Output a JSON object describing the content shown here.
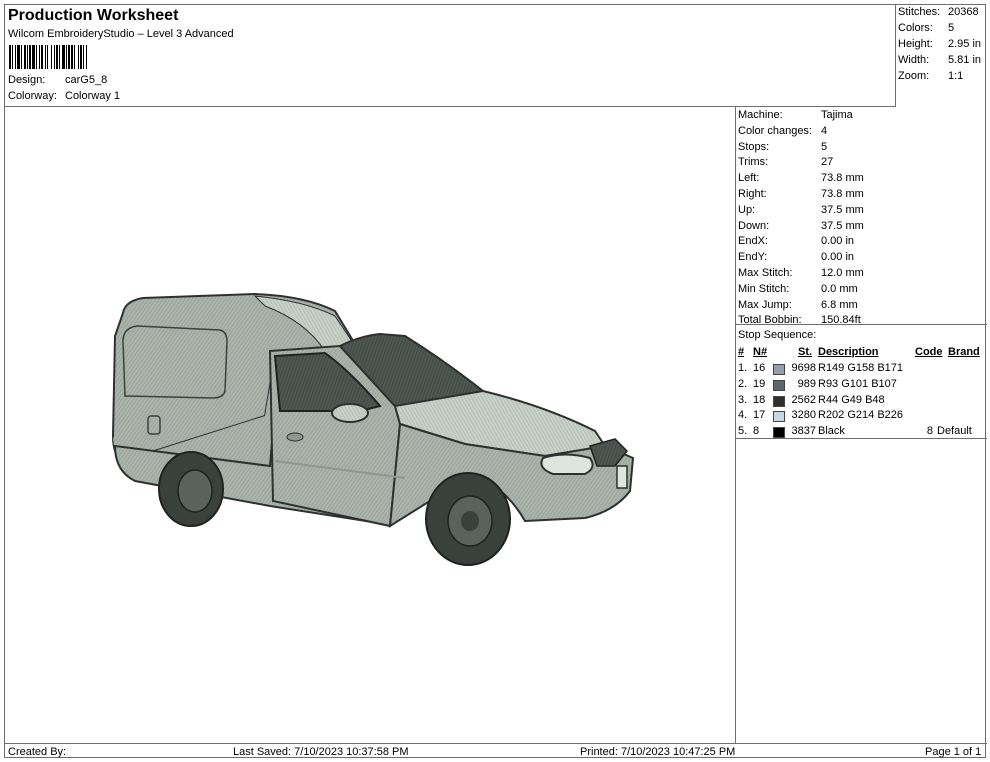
{
  "header": {
    "title": "Production Worksheet",
    "subtitle": "Wilcom EmbroideryStudio – Level 3 Advanced",
    "design_label": "Design:",
    "design_value": "carG5_8",
    "colorway_label": "Colorway:",
    "colorway_value": "Colorway 1"
  },
  "summary": {
    "stitches_label": "Stitches:",
    "stitches_value": "20368",
    "colors_label": "Colors:",
    "colors_value": "5",
    "height_label": "Height:",
    "height_value": "2.95 in",
    "width_label": "Width:",
    "width_value": "5.81 in",
    "zoom_label": "Zoom:",
    "zoom_value": "1:1"
  },
  "machine_info": [
    {
      "label": "Machine:",
      "value": "Tajima"
    },
    {
      "label": "Color changes:",
      "value": "4"
    },
    {
      "label": "Stops:",
      "value": "5"
    },
    {
      "label": "Trims:",
      "value": "27"
    },
    {
      "label": "Left:",
      "value": "73.8 mm"
    },
    {
      "label": "Right:",
      "value": "73.8 mm"
    },
    {
      "label": "Up:",
      "value": "37.5 mm"
    },
    {
      "label": "Down:",
      "value": "37.5 mm"
    },
    {
      "label": "EndX:",
      "value": "0.00 in"
    },
    {
      "label": "EndY:",
      "value": "0.00 in"
    },
    {
      "label": "Max Stitch:",
      "value": "12.0 mm"
    },
    {
      "label": "Min Stitch:",
      "value": "0.0 mm"
    },
    {
      "label": "Max Jump:",
      "value": "6.8 mm"
    },
    {
      "label": "Total Bobbin:",
      "value": "150.84ft"
    }
  ],
  "stop_sequence": {
    "title": "Stop Sequence:",
    "headers": {
      "num": "#",
      "n": "N#",
      "st": "St.",
      "description": "Description",
      "code": "Code",
      "brand": "Brand"
    },
    "rows": [
      {
        "num": "1.",
        "n": "16",
        "color": "#959eab",
        "st": "9698",
        "description": "R149 G158 B171",
        "code": "",
        "brand": ""
      },
      {
        "num": "2.",
        "n": "19",
        "color": "#5d656b",
        "st": "989",
        "description": "R93 G101 B107",
        "code": "",
        "brand": ""
      },
      {
        "num": "3.",
        "n": "18",
        "color": "#2c3130",
        "st": "2562",
        "description": "R44 G49 B48",
        "code": "",
        "brand": ""
      },
      {
        "num": "4.",
        "n": "17",
        "color": "#cad6e2",
        "st": "3280",
        "description": "R202 G214 B226",
        "code": "",
        "brand": ""
      },
      {
        "num": "5.",
        "n": "8",
        "color": "#000000",
        "st": "3837",
        "description": "Black",
        "code": "8",
        "brand": "Default"
      }
    ]
  },
  "footer": {
    "created_by": "Created By:",
    "last_saved": "Last Saved: 7/10/2023 10:37:58 PM",
    "printed": "Printed: 7/10/2023 10:47:25 PM",
    "page": "Page 1 of 1"
  },
  "colors": {
    "body": "#a3aca4",
    "body_light": "#c3ccc4",
    "glass": "#4a524d",
    "tire": "#3a403c",
    "outline": "#2c3130"
  }
}
